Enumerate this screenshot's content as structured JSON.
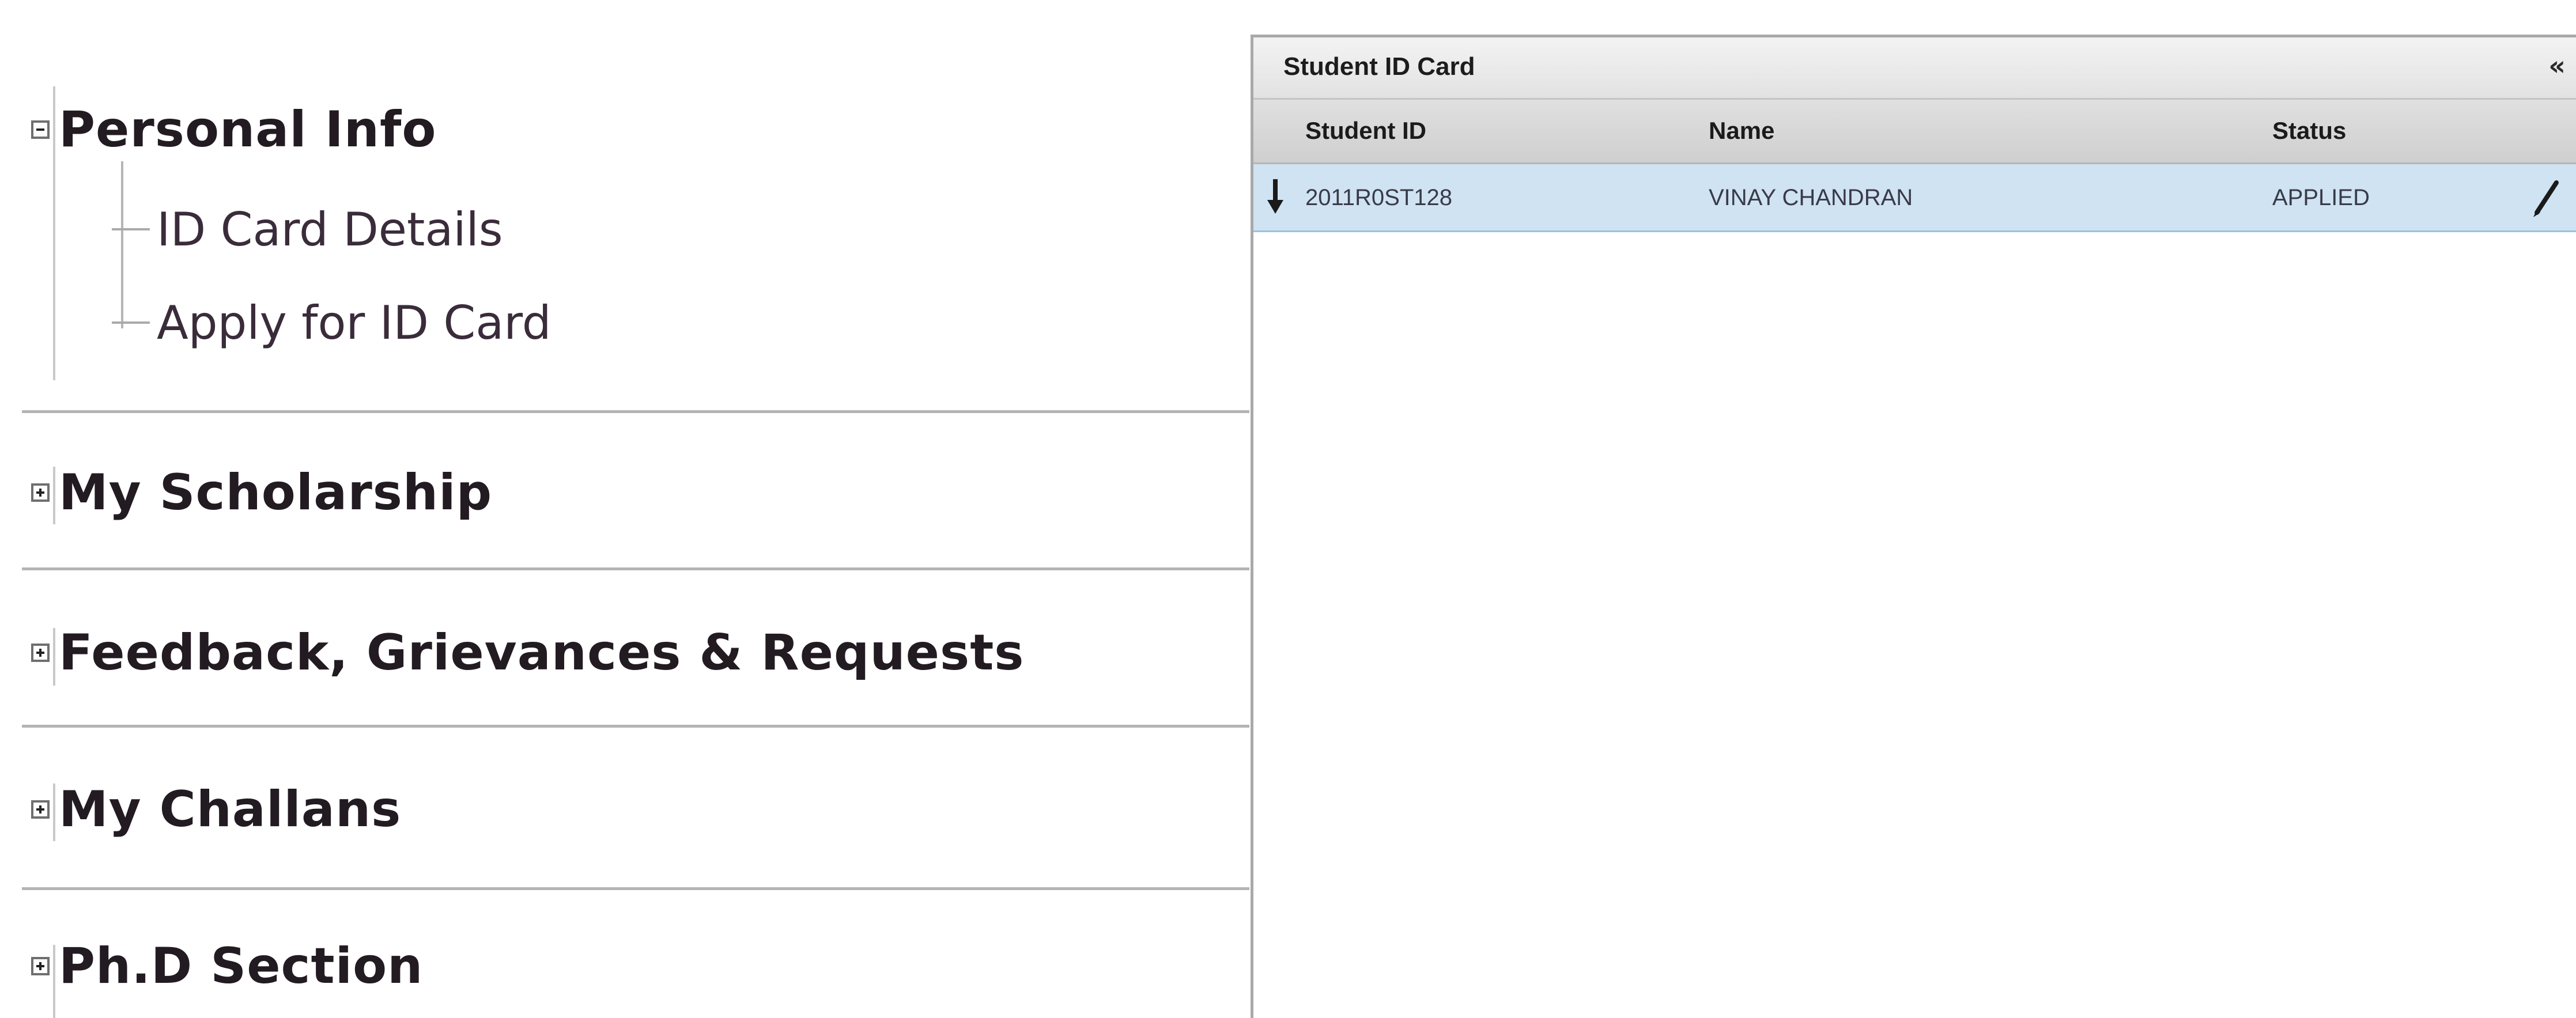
{
  "nav": {
    "personal_info": {
      "label": "Personal Info",
      "expanded": true,
      "items": [
        {
          "label": "ID Card Details"
        },
        {
          "label": "Apply for ID Card"
        }
      ]
    },
    "sections": [
      {
        "label": "My Scholarship",
        "expanded": false
      },
      {
        "label": "Feedback, Grievances & Requests",
        "expanded": false
      },
      {
        "label": "My Challans",
        "expanded": false
      },
      {
        "label": "Ph.D Section",
        "expanded": false
      }
    ]
  },
  "panel": {
    "title": "Student ID Card",
    "collapse_glyph": "«",
    "columns": [
      "Student ID",
      "Name",
      "Status"
    ],
    "rows": [
      {
        "student_id": "2011R0ST128",
        "name": "VINAY CHANDRAN",
        "status": "APPLIED",
        "selected": true
      }
    ]
  },
  "colors": {
    "selected_row": "#cfe3f2",
    "header_bg": "#d7d7d7",
    "nav_text": "#231b22"
  },
  "icons": {
    "expanded": "minus-box-icon",
    "collapsed": "plus-box-icon",
    "row_marker": "row-pointer-icon",
    "row_edit": "pencil-icon"
  }
}
